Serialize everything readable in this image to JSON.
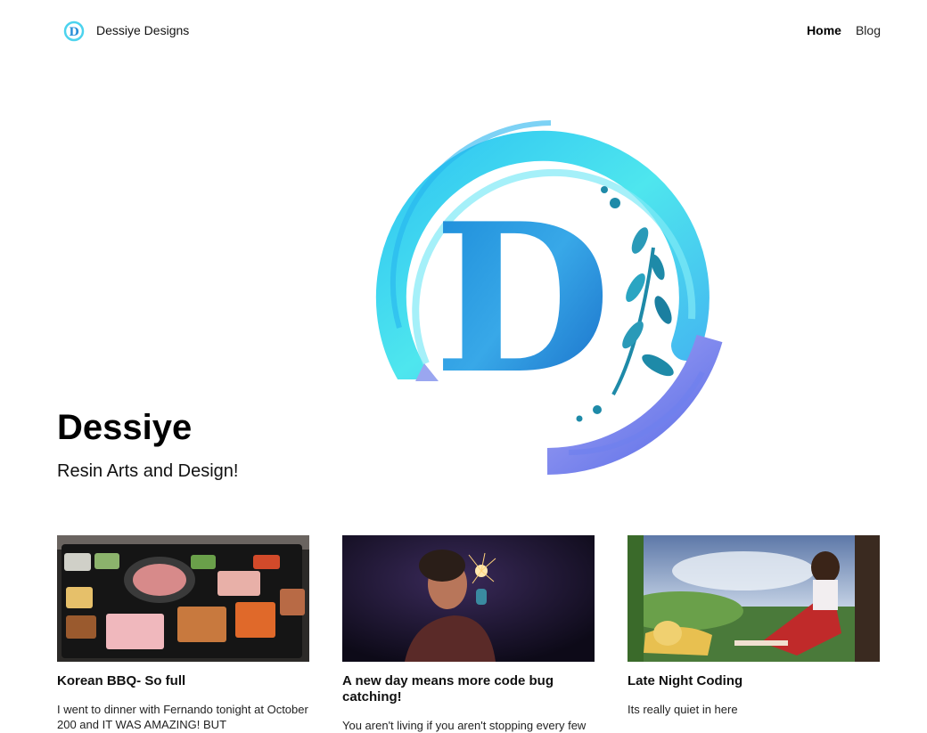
{
  "site": {
    "title": "Dessiye Designs"
  },
  "nav": {
    "items": [
      {
        "label": "Home",
        "active": true
      },
      {
        "label": "Blog",
        "active": false
      }
    ]
  },
  "hero": {
    "title": "Dessiye",
    "subtitle": "Resin Arts and Design!",
    "logo_letter": "D"
  },
  "posts": [
    {
      "title": "Korean BBQ- So full",
      "excerpt": "I went to dinner with Fernando tonight at October 200 and IT WAS AMAZING! BUT",
      "image": "grill-table-photo"
    },
    {
      "title": "A new day means more code bug catching!",
      "excerpt": "You aren't living if you aren't stopping every few",
      "image": "sparkler-portrait-photo"
    },
    {
      "title": "Late Night Coding",
      "excerpt": "Its really quiet in here",
      "image": "anime-landscape-illustration"
    }
  ],
  "colors": {
    "accent_cyan": "#3ed8f0",
    "accent_blue": "#2a7fd4",
    "accent_purple": "#8e8ef0",
    "leaf_teal": "#1e8aa8"
  }
}
